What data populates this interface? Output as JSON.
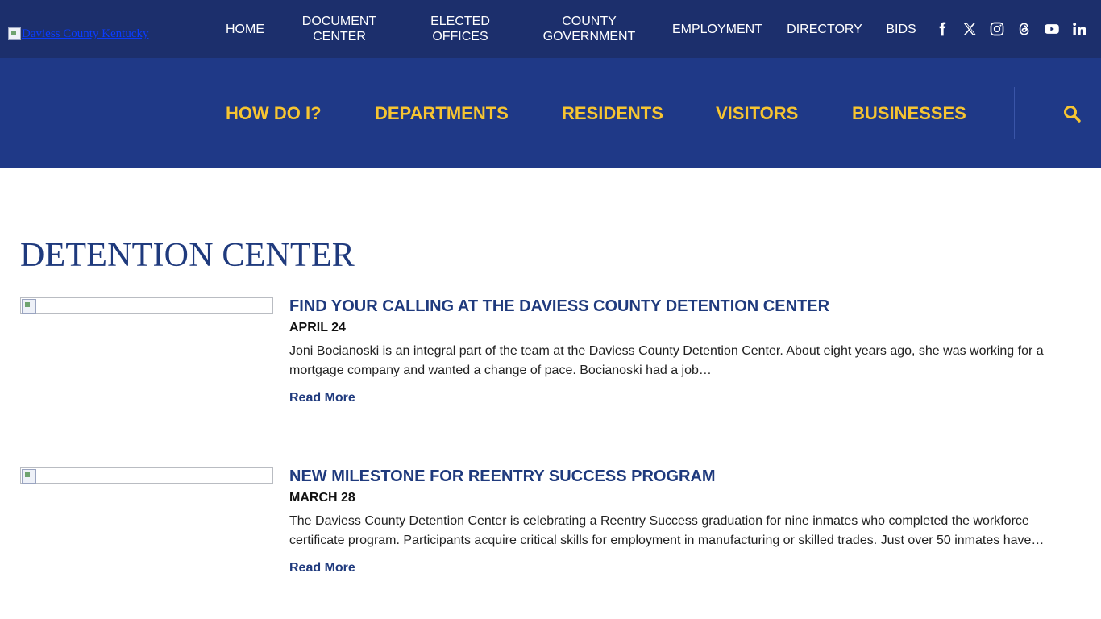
{
  "site": {
    "logo_alt": "Daviess County Kentucky"
  },
  "top_nav": [
    {
      "label": "HOME"
    },
    {
      "label": "DOCUMENT\nCENTER"
    },
    {
      "label": "ELECTED\nOFFICES"
    },
    {
      "label": "COUNTY\nGOVERNMENT"
    },
    {
      "label": "EMPLOYMENT"
    },
    {
      "label": "DIRECTORY"
    },
    {
      "label": "BIDS"
    }
  ],
  "social_icons": [
    "facebook-icon",
    "x-twitter-icon",
    "instagram-icon",
    "threads-icon",
    "youtube-icon",
    "linkedin-icon"
  ],
  "main_nav": [
    {
      "label": "HOW DO I?"
    },
    {
      "label": "DEPARTMENTS"
    },
    {
      "label": "RESIDENTS"
    },
    {
      "label": "VISITORS"
    },
    {
      "label": "BUSINESSES"
    }
  ],
  "search_icon": "search-icon",
  "page": {
    "title": "DETENTION CENTER"
  },
  "articles": [
    {
      "title": "FIND YOUR CALLING AT THE DAVIESS COUNTY DETENTION CENTER",
      "date": "APRIL 24",
      "excerpt": "Joni Bocianoski is an integral part of the team at the Daviess County Detention Center. About eight years ago, she was working for a mortgage company and wanted a change of pace. Bocianoski had a job…",
      "read_more": "Read More"
    },
    {
      "title": "NEW MILESTONE FOR REENTRY SUCCESS PROGRAM",
      "date": "MARCH 28",
      "excerpt": "The Daviess County Detention Center is celebrating a Reentry Success graduation for nine inmates who completed the workforce certificate program. Participants acquire critical skills for employment in manufacturing or skilled trades. Just over 50 inmates have…",
      "read_more": "Read More"
    }
  ],
  "colors": {
    "topbar": "#1c2f6c",
    "mainnav": "#1f3987",
    "accent_gold": "#f7c531",
    "brand_blue": "#1f3a7d"
  }
}
